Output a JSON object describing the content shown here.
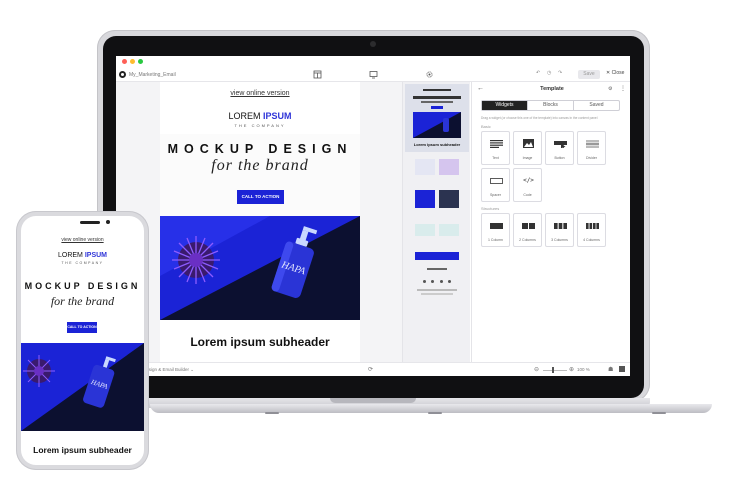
{
  "app": {
    "project_label": "My_Marketing_Email",
    "save_label": "Save",
    "close_label": "Close",
    "bottom_left_label": "Design & Email Builder",
    "zoom": "100 %"
  },
  "email": {
    "view_online": "view online version",
    "logo_main": "LOREM",
    "logo_accent": "IPSUM",
    "tagline": "THE COMPANY",
    "headline": "MOCKUP DESIGN",
    "subline": "for the brand",
    "cta": "CALL TO ACTION",
    "subheader": "Lorem ipsum subheader",
    "bottle_text": "HAPA"
  },
  "panel": {
    "title": "Template",
    "tabs": [
      {
        "label": "Widgets",
        "active": true
      },
      {
        "label": "Blocks",
        "active": false
      },
      {
        "label": "Saved",
        "active": false
      }
    ],
    "hint": "Drag a widget (or choose this one of the template) into canvas in the content panel",
    "basic_label": "Basic",
    "widgets": [
      {
        "label": "Text",
        "icon": "text-lines-icon"
      },
      {
        "label": "Image",
        "icon": "image-icon"
      },
      {
        "label": "Button",
        "icon": "button-icon"
      },
      {
        "label": "Divider",
        "icon": "divider-icon"
      },
      {
        "label": "Spacer",
        "icon": "spacer-icon"
      },
      {
        "label": "Code",
        "icon": "code-icon"
      }
    ],
    "structures_label": "Structures",
    "structures": [
      {
        "label": "1 Column"
      },
      {
        "label": "2 Columns"
      },
      {
        "label": "3 Columns"
      },
      {
        "label": "4 Columns"
      }
    ]
  },
  "preview": {
    "subheader": "Lorem ipsum subheader"
  },
  "colors": {
    "accent": "#1b23d6",
    "hero_dark": "#0c1030",
    "hero_blue": "#1b23d6"
  }
}
